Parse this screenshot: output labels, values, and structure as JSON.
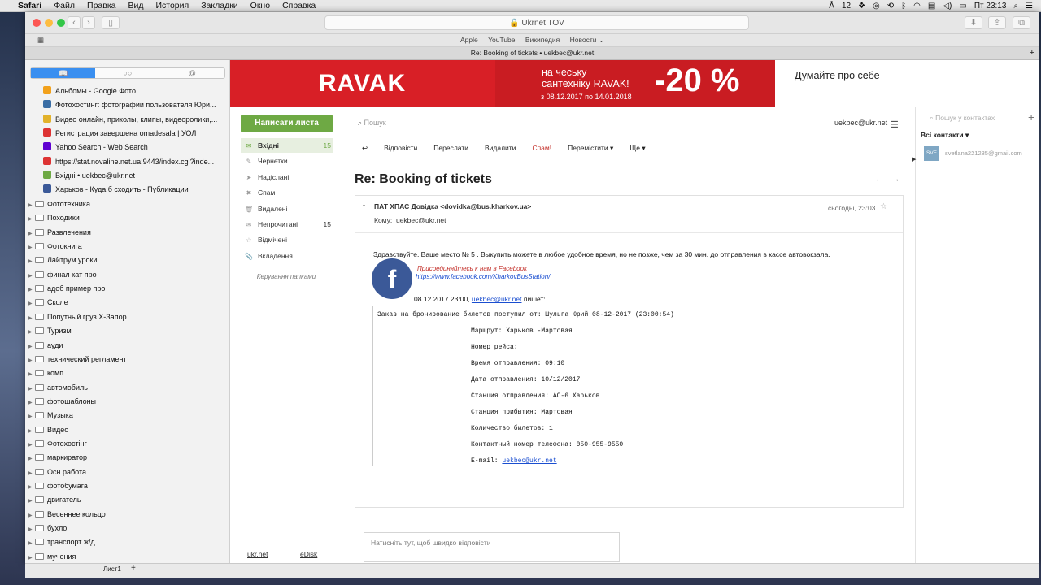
{
  "menubar": {
    "app": "Safari",
    "items": [
      "Файл",
      "Правка",
      "Вид",
      "История",
      "Закладки",
      "Окно",
      "Справка"
    ],
    "input_indicator": "12",
    "clock": "Пт 23:13"
  },
  "browser": {
    "url": "Ukrnet TOV",
    "favorites": [
      "Apple",
      "YouTube",
      "Википедия",
      "Новости ⌄"
    ],
    "tab_title": "Re: Booking of tickets • uekbec@ukr.net"
  },
  "sidebar": {
    "bookmarks": [
      {
        "label": "Альбомы - Google Фото",
        "color": "#f2a11b"
      },
      {
        "label": "Фотохостинг: фотографии пользователя Юри...",
        "color": "#3a6ea5"
      },
      {
        "label": "Видео онлайн, приколы, клипы, видеоролики,...",
        "color": "#e2b22b"
      },
      {
        "label": "Регистрация завершена omadesala | УОЛ",
        "color": "#d33"
      },
      {
        "label": "Yahoo Search - Web Search",
        "color": "#5f01d1"
      },
      {
        "label": "https://stat.novaline.net.ua:9443/index.cgi?inde...",
        "color": "#d33"
      },
      {
        "label": "Вхідні • uekbec@ukr.net",
        "color": "#6ea944"
      },
      {
        "label": "Харьков - Куда б сходить - Публикации",
        "color": "#3b5998"
      }
    ],
    "folders": [
      "Фототехника",
      "Походики",
      "Развлечения",
      "Фотокнига",
      "Лайтрум уроки",
      "финал кат про",
      "адоб пример про",
      "Сколе",
      "Попутный груз Х-Запор",
      "Туризм",
      "ауди",
      "технический регламент",
      "комп",
      "автомобиль",
      "фотошаблоны",
      "Музыка",
      "Видео",
      "Фотохостінг",
      "маркиратор",
      "Осн работа",
      "фотобумага",
      "двигатель",
      "Весеннее кольцо",
      "бухло",
      "транспорт ж/д",
      "мучения"
    ]
  },
  "ad": {
    "brand": "RAVAK",
    "line1": "на чеську",
    "line2": "сантехніку RAVAK!",
    "dates": "з 08.12.2017 по 14.01.2018",
    "discount": "-20 %",
    "about": "Думайте про себе"
  },
  "mail": {
    "compose": "Написати листа",
    "folders": [
      {
        "label": "Вхідні",
        "count": "15",
        "icon": "✉"
      },
      {
        "label": "Чернетки",
        "count": "",
        "icon": "✎"
      },
      {
        "label": "Надіслані",
        "count": "",
        "icon": "➤"
      },
      {
        "label": "Спам",
        "count": "",
        "icon": "✖"
      },
      {
        "label": "Видалені",
        "count": "",
        "icon": "🗑"
      },
      {
        "label": "Непрочитані",
        "count": "15",
        "icon": "✉"
      },
      {
        "label": "Відмічені",
        "count": "",
        "icon": "☆"
      },
      {
        "label": "Вкладення",
        "count": "",
        "icon": "📎"
      }
    ],
    "manage": "Керування папками",
    "footer_links": [
      "ukr.net",
      "eDisk"
    ],
    "search_placeholder": "Пошук",
    "user": "uekbec@ukr.net",
    "actions": [
      "Відповісти",
      "Переслати",
      "Видалити",
      "Спам!",
      "Перемістити ▾",
      "Ще ▾"
    ],
    "subject": "Re: Booking of tickets",
    "from": "ПАТ ХПАС Довідка <dovidka@bus.kharkov.ua>",
    "to_label": "Кому:",
    "to": "uekbec@ukr.net",
    "date": "сьогодні, 23:03",
    "body_text": "Здравствуйте. Ваше место № 5  . Выкупить можете в любое удобное время, но не позже, чем за 30 мин. до отправления в кассе автовокзала.",
    "fb_join": "Присоединяйтесь к нам в Facebook",
    "fb_link": "https://www.facebook.com/KharkovBusStation/",
    "quote_date": "08.12.2017 23:00,",
    "quote_author": "uekbec@ukr.net",
    "quote_wrote": "пишет:",
    "quote_header": "Заказ на бронирование билетов поступил от: Шульга Юрий 08-12-2017 (23:00:54)",
    "quote_lines": [
      "Маршрут: Харьков -Мартовая",
      "Номер рейса:",
      "Время отправления:  09:10",
      "Дата отправления:  10/12/2017",
      "Станция отправления: АС-6 Харьков",
      "Станция прибытия: Мартовая",
      "Количество билетов: 1",
      "Контактный номер телефона:  050-955-9550"
    ],
    "email_label": "E-mail:",
    "email_value": "uekbec@ukr.net",
    "reply_placeholder": "Натисніть тут, щоб швидко відповісти"
  },
  "contacts": {
    "search_placeholder": "Пошук у контактах",
    "all": "Всі контакти ▾",
    "avatar": "SVE",
    "email": "svetlana221285@gmail.com"
  },
  "bottom": {
    "sheet": "Лист1"
  }
}
